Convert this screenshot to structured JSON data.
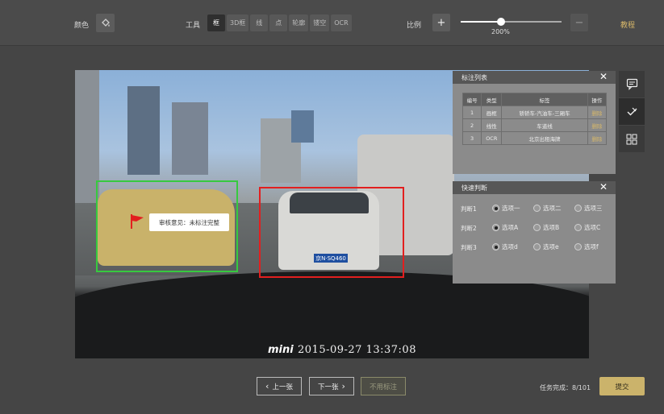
{
  "toolbar": {
    "color_label": "颜色",
    "tools_label": "工具",
    "tools": [
      "框",
      "3D框",
      "线",
      "点",
      "轮廓",
      "镂空",
      "OCR"
    ],
    "active_tool": "框",
    "scale_label": "比例",
    "zoom_in": "+",
    "zoom_out": "−",
    "zoom_value": "200%",
    "zoom_fraction": 0.4,
    "tutorial": "教程"
  },
  "canvas": {
    "review_comment": "审核意见：未标注完整",
    "plate_text": "京N·SQ460",
    "logo": "mini",
    "timestamp": "2015-09-27  13:37:08",
    "colors": {
      "box_green": "#37c93f",
      "box_red": "#e21f1f"
    }
  },
  "annotation_list": {
    "title": "标注列表",
    "close": "✕",
    "headers": [
      "编号",
      "类型",
      "标签",
      "操作"
    ],
    "rows": [
      {
        "id": "1",
        "type": "画框",
        "label": "轿轿车-汽油车-三厢车",
        "action": "删除"
      },
      {
        "id": "2",
        "type": "线性",
        "label": "车道线",
        "action": "删除"
      },
      {
        "id": "3",
        "type": "OCR",
        "label": "北京出租海牌",
        "action": "删除"
      }
    ]
  },
  "quick_judge": {
    "title": "快速判断",
    "close": "✕",
    "rows": [
      {
        "label": "判断1",
        "options": [
          "选项一",
          "选项二",
          "选项三"
        ],
        "selected": 0
      },
      {
        "label": "判断2",
        "options": [
          "选项A",
          "选项B",
          "选项C"
        ],
        "selected": 0
      },
      {
        "label": "判断3",
        "options": [
          "选项d",
          "选项e",
          "选项f"
        ],
        "selected": 0
      }
    ]
  },
  "footer": {
    "prev": "上一张",
    "next": "下一张",
    "unused": "不用标注",
    "progress": "任务完成：8/101",
    "submit": "提交"
  }
}
